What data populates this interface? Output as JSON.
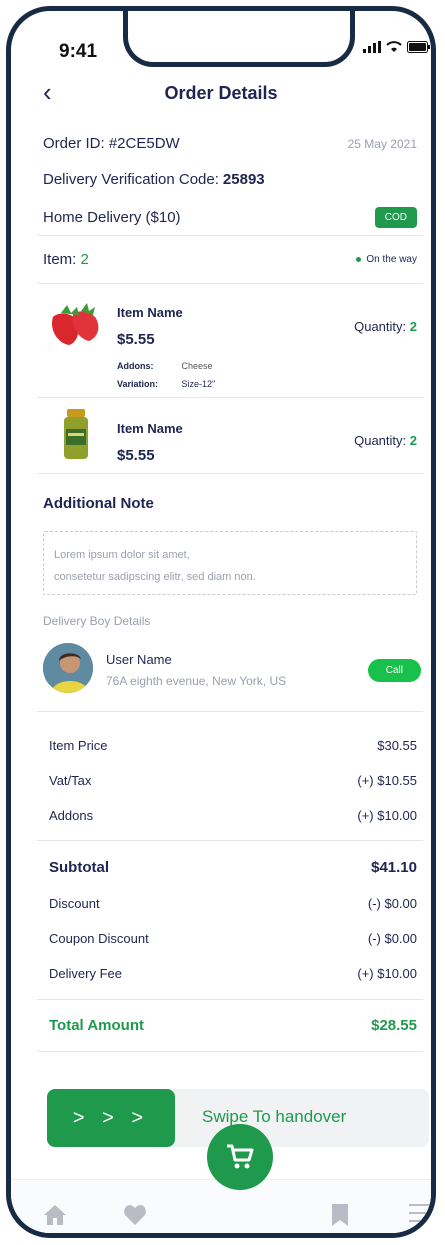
{
  "status": {
    "time": "9:41"
  },
  "header": {
    "title": "Order Details"
  },
  "order": {
    "id_label": "Order ID: #2CE5DW",
    "date": "25 May 2021",
    "code_label": "Delivery Verification Code:",
    "code_value": "25893",
    "delivery": "Home Delivery ($10)",
    "payment_badge": "COD",
    "items_label": "Item:",
    "items_count": "2",
    "status": "On the way"
  },
  "items": [
    {
      "name": "Item Name",
      "price": "$5.55",
      "qty_label": "Quantity:",
      "qty": "2",
      "addons_label": "Addons:",
      "addons_value": "Cheese",
      "variation_label": "Variation:",
      "variation_value": "Size-12\""
    },
    {
      "name": "Item Name",
      "price": "$5.55",
      "qty_label": "Quantity:",
      "qty": "2"
    }
  ],
  "note": {
    "title": "Additional Note",
    "line1": "Lorem ipsum dolor sit amet,",
    "line2": "consetetur sadipscing elitr, sed diam non."
  },
  "delivery_boy": {
    "section_label": "Delivery Boy Details",
    "name": "User Name",
    "address": "76A eighth evenue, New York, US",
    "call_label": "Call"
  },
  "summary": {
    "item_price_label": "Item Price",
    "item_price": "$30.55",
    "vat_label": "Vat/Tax",
    "vat": "(+) $10.55",
    "addons_label": "Addons",
    "addons": "(+) $10.00",
    "subtotal_label": "Subtotal",
    "subtotal": "$41.10",
    "discount_label": "Discount",
    "discount": "(-) $0.00",
    "coupon_label": "Coupon Discount",
    "coupon": "(-) $0.00",
    "fee_label": "Delivery Fee",
    "fee": "(+) $10.00",
    "total_label": "Total Amount",
    "total": "$28.55"
  },
  "swipe": {
    "arrows": "> > >",
    "label": "Swipe To handover"
  },
  "colors": {
    "accent": "#1f9a4c",
    "text": "#1f2550",
    "frame": "#172b44"
  },
  "nav": {
    "icons": [
      "home-icon",
      "heart-icon",
      "cart-icon",
      "bookmark-icon",
      "menu-icon"
    ]
  }
}
